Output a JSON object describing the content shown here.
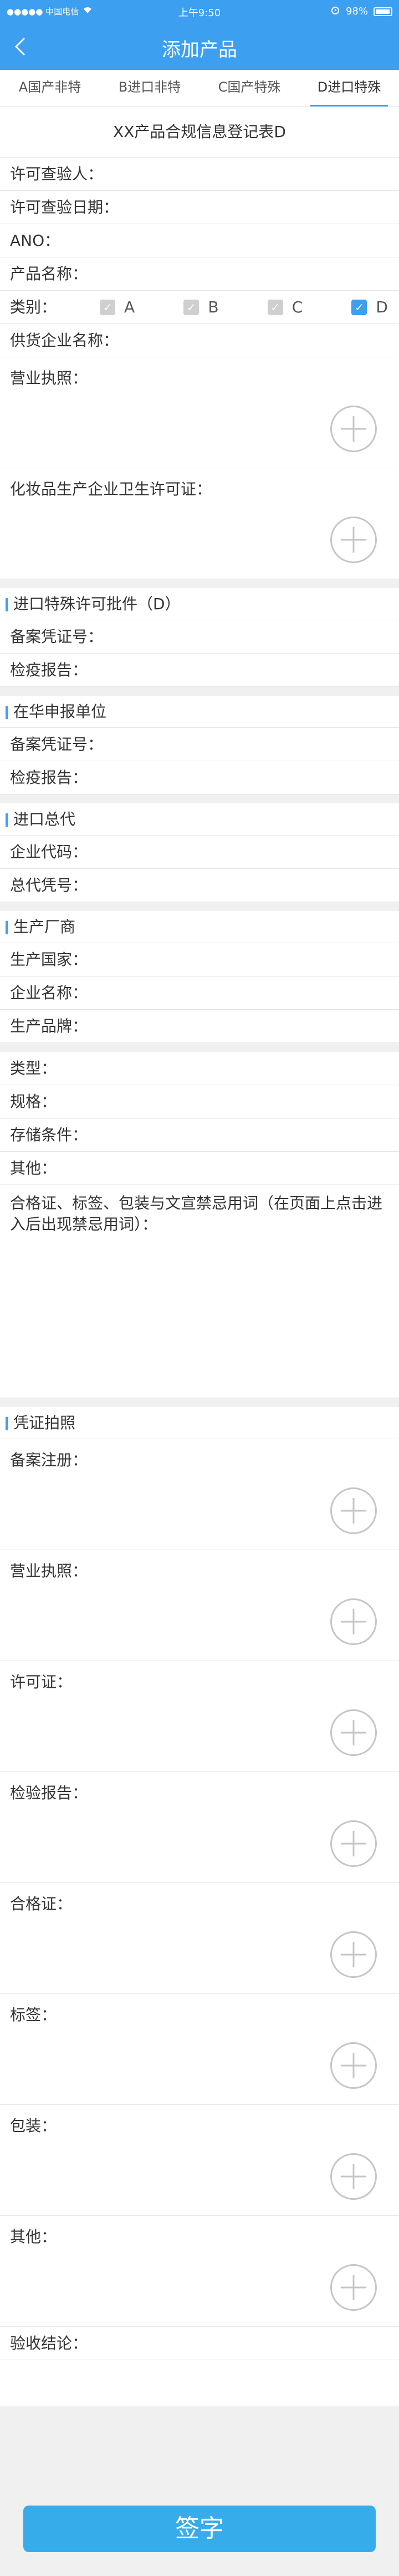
{
  "status_bar": {
    "carrier": "●●●●● 中国电信",
    "time": "上午9:50",
    "battery": "98%"
  },
  "nav": {
    "title": "添加产品"
  },
  "tabs": [
    "A国产非特",
    "B进口非特",
    "C国产特殊",
    "D进口特殊"
  ],
  "form_title": "XX产品合规信息登记表D",
  "basic": {
    "inspector": "许可查验人：",
    "inspect_date": "许可查验日期：",
    "ano": "ANO：",
    "product_name": "产品名称：",
    "category_label": "类别：",
    "categories": [
      {
        "label": "A",
        "checked": false
      },
      {
        "label": "B",
        "checked": false
      },
      {
        "label": "C",
        "checked": false
      },
      {
        "label": "D",
        "checked": true
      }
    ],
    "supplier": "供货企业名称："
  },
  "uploads_top": {
    "business_license": "营业执照：",
    "cosmetic_license": "化妆品生产企业卫生许可证："
  },
  "section_import": {
    "title": "进口特殊许可批件（D）",
    "filing_no": "备案凭证号：",
    "inspection_report": "检疫报告："
  },
  "section_china": {
    "title": "在华申报单位",
    "filing_no": "备案凭证号：",
    "inspection_report": "检疫报告："
  },
  "section_agent": {
    "title": "进口总代",
    "company_code": "企业代码：",
    "agent_no": "总代凭号："
  },
  "section_maker": {
    "title": "生产厂商",
    "country": "生产国家：",
    "company_name": "企业名称：",
    "brand": "生产品牌："
  },
  "details": {
    "type": "类型：",
    "spec": "规格：",
    "storage": "存储条件：",
    "other": "其他：",
    "labels_note": "合格证、标签、包装与文宣禁忌用词（在页面上点击进入后出现禁忌用词）："
  },
  "section_photos": {
    "title": "凭证拍照"
  },
  "photo_uploads": [
    "备案注册：",
    "营业执照：",
    "许可证：",
    "检验报告：",
    "合格证：",
    "标签：",
    "包装：",
    "其他："
  ],
  "conclusion": "验收结论：",
  "sign_button": "签字",
  "colors": {
    "primary": "#3d9ff0",
    "button": "#36adea",
    "bg_gray": "#f0f0f0"
  }
}
